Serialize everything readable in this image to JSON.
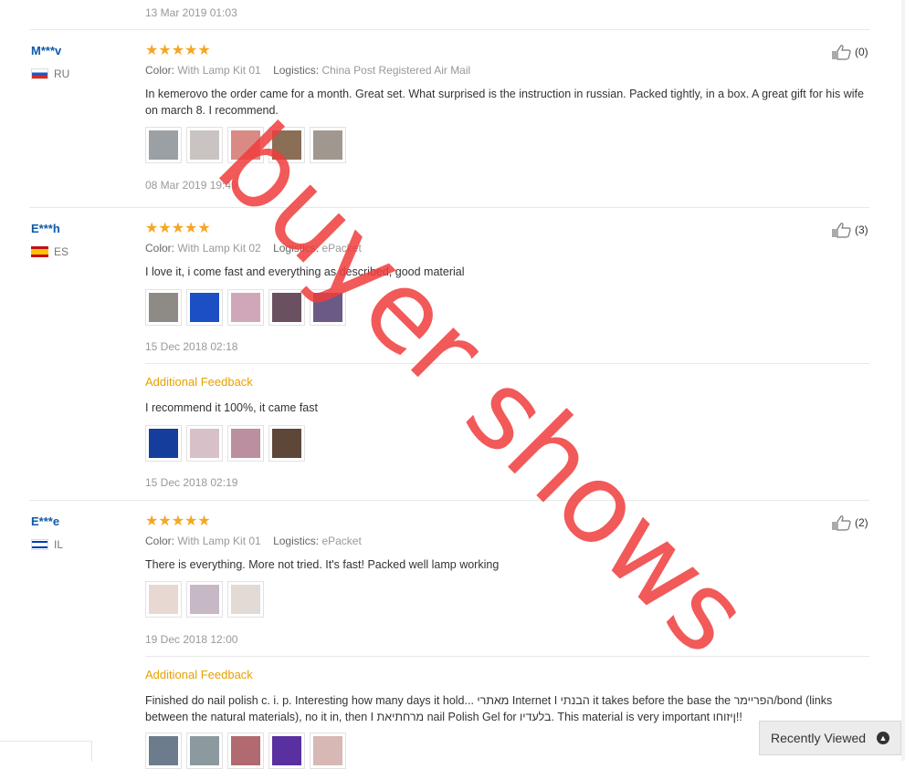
{
  "top_date": "13 Mar 2019 01:03",
  "reviews": [
    {
      "user": "M***v",
      "country": "RU",
      "stars": "★★★★★",
      "color_label": "Color:",
      "color": "With Lamp Kit 01",
      "logistics_label": "Logistics:",
      "logistics": "China Post Registered Air Mail",
      "text": "In kemerovo the order came for a month. Great set. What surprised is the instruction in russian. Packed tightly, in a box. A great gift for his wife on march 8. I recommend.",
      "date": "08 Mar 2019 19:49",
      "likes": "(0)",
      "thumb_colors": [
        "#9aa0a4",
        "#c9c4c2",
        "#d98a84",
        "#8a6e56",
        "#a09890"
      ]
    },
    {
      "user": "E***h",
      "country": "ES",
      "stars": "★★★★★",
      "color_label": "Color:",
      "color": "With Lamp Kit 02",
      "logistics_label": "Logistics:",
      "logistics": "ePacket",
      "text": "I love it, i come fast and everything as described, good material",
      "date": "15 Dec 2018 02:18",
      "likes": "(3)",
      "thumb_colors": [
        "#8e8a86",
        "#1c4fc4",
        "#cfa7b8",
        "#6a5060",
        "#6c5a86"
      ],
      "additional": {
        "label": "Additional Feedback",
        "text": "I recommend it 100%, it came fast",
        "date": "15 Dec 2018 02:19",
        "thumb_colors": [
          "#153d9c",
          "#d7c0c8",
          "#bb8f9f",
          "#5e4638"
        ]
      }
    },
    {
      "user": "E***e",
      "country": "IL",
      "stars": "★★★★★",
      "color_label": "Color:",
      "color": "With Lamp Kit 01",
      "logistics_label": "Logistics:",
      "logistics": "ePacket",
      "text": "There is everything. More not tried. It's fast! Packed well lamp working",
      "date": "19 Dec 2018 12:00",
      "likes": "(2)",
      "thumb_colors": [
        "#e8d8d2",
        "#c6b8c4",
        "#e2dad4"
      ],
      "additional": {
        "label": "Additional Feedback",
        "text": "Finished do nail polish c. i. p. Interesting how many days it hold... מאתרי Internet I הבנתי it takes before the base the הפריימר/bond (links between the natural materials), no it in, then I מרחתיאת nail Polish Gel for בלעדיו. This material is very important ןיזוחו!!",
        "thumb_colors": [
          "#6c7c8c",
          "#8c9aa0",
          "#b06a70",
          "#5a30a0",
          "#d8b8b4"
        ]
      }
    }
  ],
  "watermark": "buyer shows",
  "recently_viewed": "Recently Viewed"
}
